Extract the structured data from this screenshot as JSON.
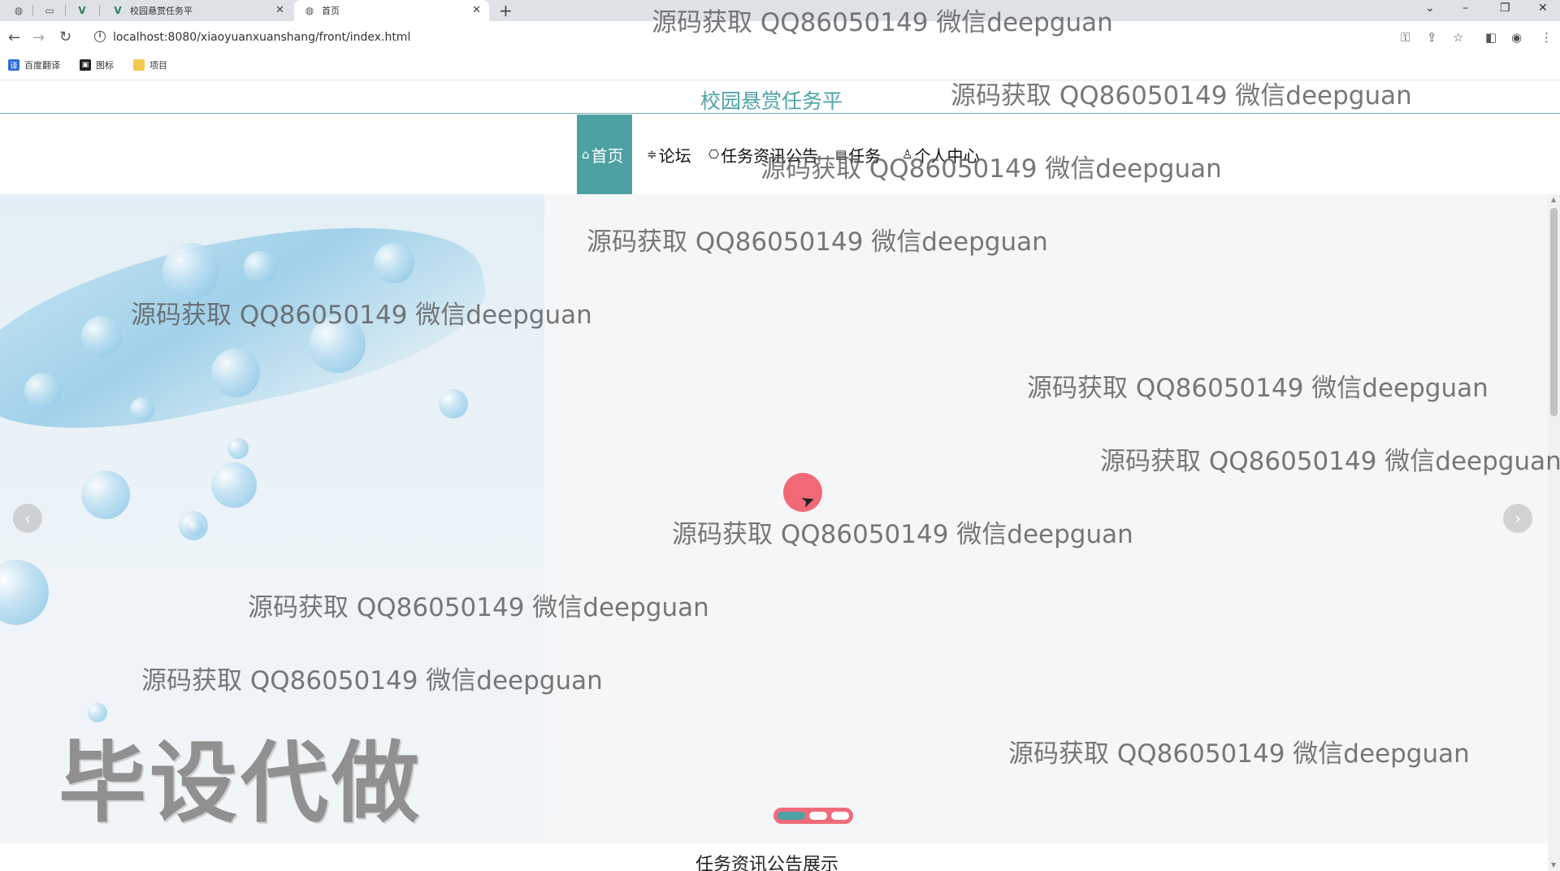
{
  "browser": {
    "tabs": [
      {
        "label": "校园悬赏任务平",
        "icon": "vue-icon"
      },
      {
        "label": "首页",
        "icon": "globe-icon"
      }
    ],
    "new_tab": "+",
    "url": "localhost:8080/xiaoyuanxuanshang/front/index.html",
    "bookmarks": [
      {
        "label": "百度翻译",
        "icon": "baidu-translate-icon"
      },
      {
        "label": "图标",
        "icon": "image-icon"
      },
      {
        "label": "项目",
        "icon": "folder-icon"
      }
    ]
  },
  "site": {
    "title": "校园悬赏任务平"
  },
  "nav": {
    "items": [
      {
        "icon": "⌂",
        "label": "首页"
      },
      {
        "icon": "≑",
        "label": "论坛"
      },
      {
        "icon": "⎔",
        "label": "任务资讯公告"
      },
      {
        "icon": "▤",
        "label": "任务"
      },
      {
        "icon": "♙",
        "label": "个人中心"
      }
    ]
  },
  "banner": {
    "overlay_text": "毕设代做",
    "slides_total": 3,
    "active_slide": 1,
    "prev_symbol": "‹",
    "next_symbol": "›"
  },
  "section": {
    "title": "任务资讯公告展示"
  },
  "watermark": "源码获取 QQ86050149 微信deepguan",
  "colors": {
    "accent": "#4ea1a3",
    "indicator_bg": "#f06b7a",
    "watermark": "#5f5f5f"
  }
}
